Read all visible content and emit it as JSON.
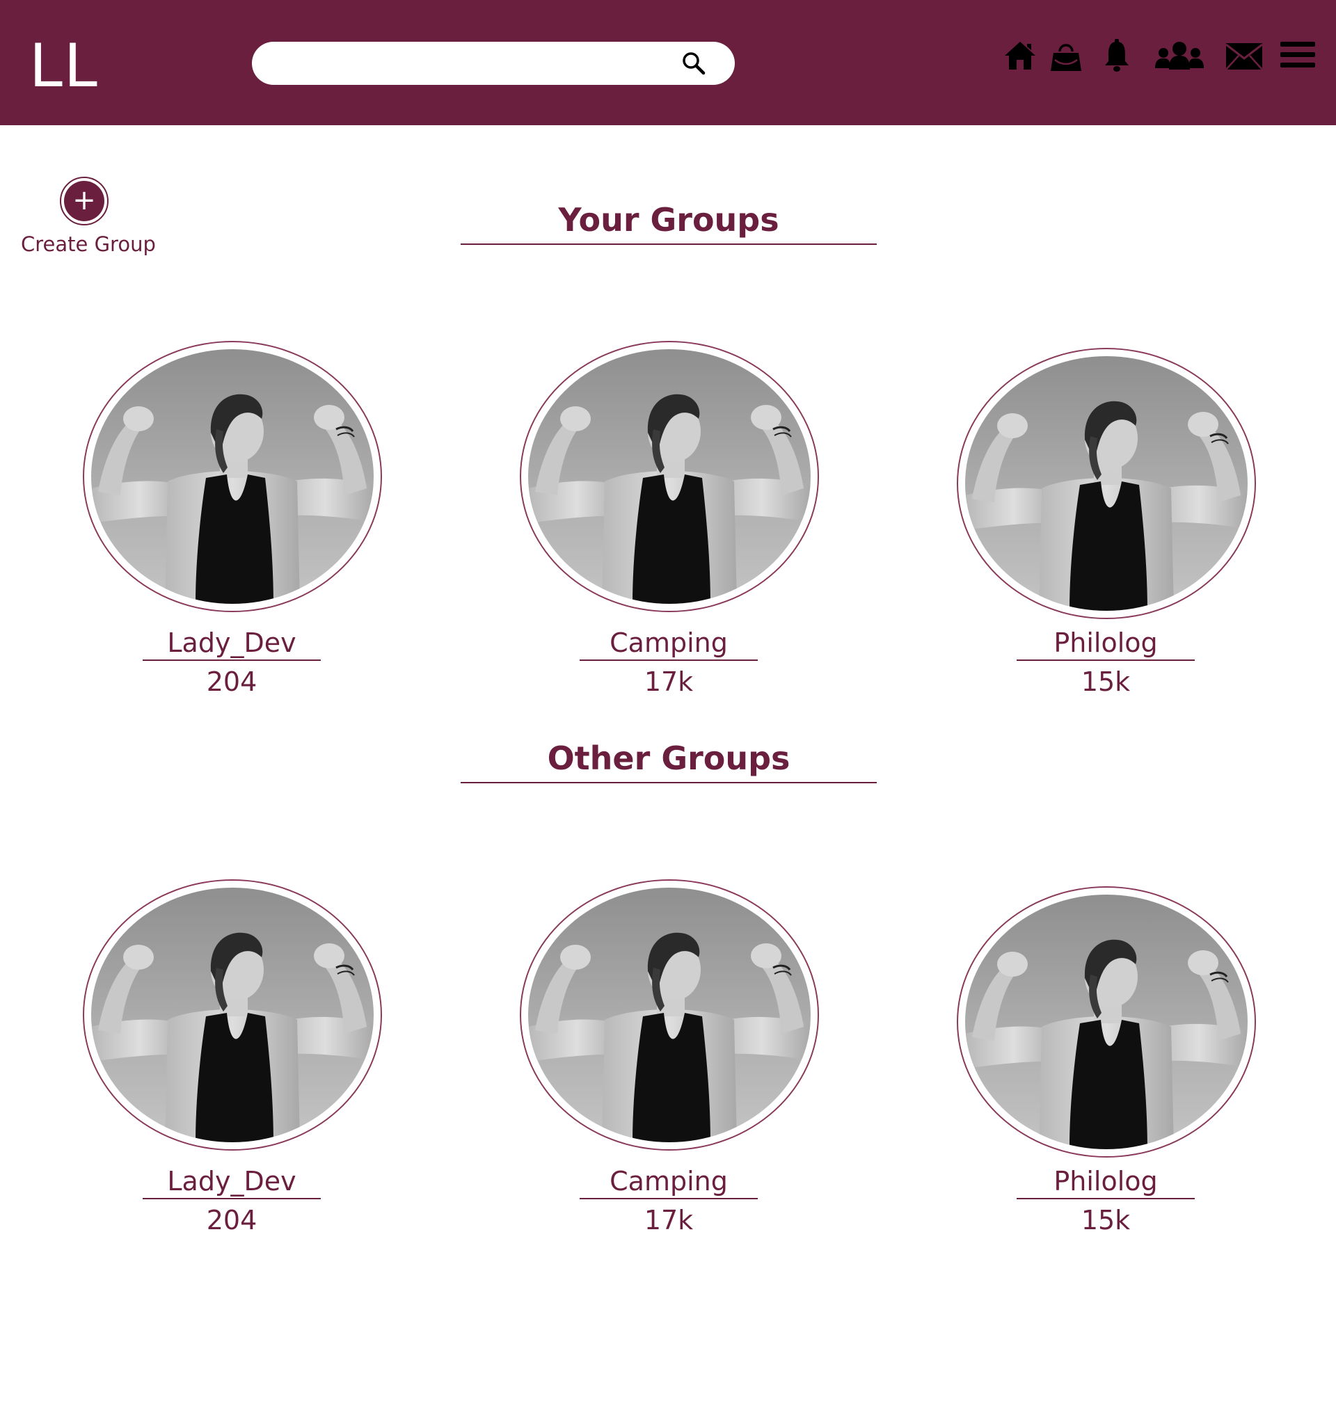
{
  "header": {
    "logo": "LL",
    "search": {
      "value": "",
      "placeholder": ""
    },
    "icons": [
      "home-icon",
      "shopping-bag-icon",
      "bell-icon",
      "community-icon",
      "mail-icon",
      "menu-icon"
    ]
  },
  "create_group": {
    "label": "Create Group",
    "icon": "plus-icon"
  },
  "sections": {
    "your_groups": {
      "title": "Your Groups",
      "groups": [
        {
          "name": "Lady_Dev",
          "count": "204"
        },
        {
          "name": "Camping",
          "count": "17k"
        },
        {
          "name": "Philolog",
          "count": "15k"
        }
      ]
    },
    "other_groups": {
      "title": "Other Groups",
      "groups": [
        {
          "name": "Lady_Dev",
          "count": "204"
        },
        {
          "name": "Camping",
          "count": "17k"
        },
        {
          "name": "Philolog",
          "count": "15k"
        }
      ]
    }
  },
  "colors": {
    "brand": "#6b1f3e",
    "white": "#ffffff"
  }
}
